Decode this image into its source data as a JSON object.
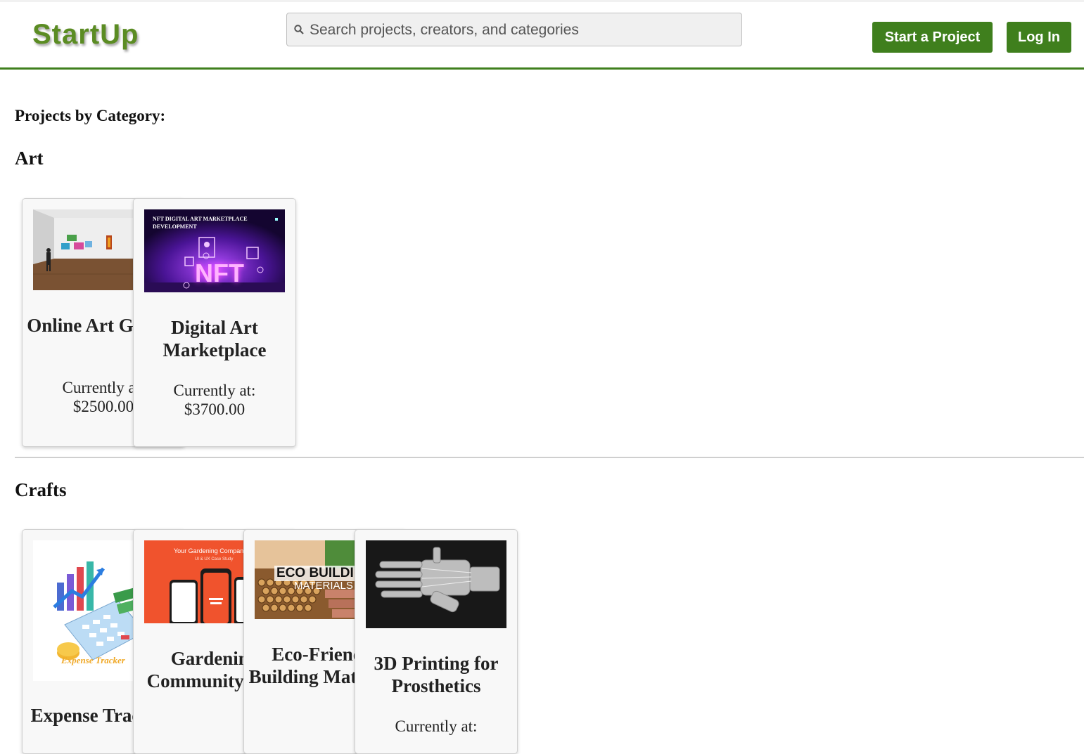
{
  "header": {
    "logo": "StartUp",
    "search_placeholder": "Search projects, creators, and categories",
    "start_project": "Start a Project",
    "login": "Log In"
  },
  "main": {
    "heading": "Projects by Category:",
    "categories": [
      {
        "name": "Art",
        "projects": [
          {
            "title": "Online Art Gallery",
            "label": "Currently at:",
            "amount": "$2500.00"
          },
          {
            "title": "Digital Art Marketplace",
            "label": "Currently at:",
            "amount": "$3700.00",
            "image_text": "NFT DIGITAL ART MARKETPLACE DEVELOPMENT",
            "image_big_text": "NFT"
          }
        ]
      },
      {
        "name": "Crafts",
        "projects": [
          {
            "title": "Expense Tracking",
            "image_text": "Expense Tracker"
          },
          {
            "title": "Gardening Community App",
            "image_text": "Your Gardening Companion",
            "image_sub": "UI & UX Case Study"
          },
          {
            "title": "Eco-Friendly Building Materials",
            "image_text": "ECO BUILDING",
            "image_sub": "MATERIALS"
          },
          {
            "title": "3D Printing for Prosthetics",
            "label": "Currently at:"
          }
        ]
      }
    ]
  },
  "colors": {
    "brand_green": "#3f7f1d",
    "logo_green": "#5b8c23"
  }
}
